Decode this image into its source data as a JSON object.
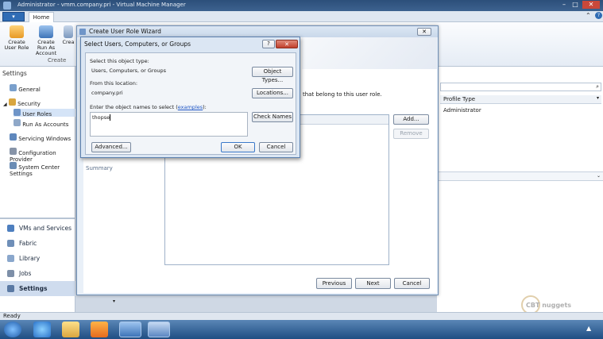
{
  "app": {
    "title": "Administrator - vmm.company.pri - Virtual Machine Manager",
    "file_tab": "▾",
    "home_tab": "Home",
    "status_text": "Ready"
  },
  "ribbon": {
    "buttons": [
      {
        "label": "Create User Role",
        "icon": "create-user-role-icon"
      },
      {
        "label": "Create Run As Account",
        "icon": "create-run-as-account-icon"
      },
      {
        "label": "Crea",
        "icon": "create-icon"
      }
    ],
    "group_label": "Create"
  },
  "leftnav": {
    "header": "Settings",
    "items": [
      {
        "label": "General",
        "icon": "general-icon"
      },
      {
        "label": "Security",
        "icon": "security-icon"
      },
      {
        "label": "User Roles",
        "icon": "user-roles-icon"
      },
      {
        "label": "Run As Accounts",
        "icon": "run-as-accounts-icon"
      },
      {
        "label": "Servicing Windows",
        "icon": "servicing-windows-icon"
      },
      {
        "label": "Configuration Provider",
        "icon": "configuration-provider-icon"
      },
      {
        "label": "System Center Settings",
        "icon": "system-center-settings-icon"
      }
    ],
    "workspaces": [
      {
        "label": "VMs and Services",
        "icon": "vms-icon"
      },
      {
        "label": "Fabric",
        "icon": "fabric-icon"
      },
      {
        "label": "Library",
        "icon": "library-icon"
      },
      {
        "label": "Jobs",
        "icon": "jobs-icon"
      },
      {
        "label": "Settings",
        "icon": "settings-icon"
      }
    ]
  },
  "grid": {
    "column_header": "Profile Type",
    "row_value": "Administrator"
  },
  "wizard": {
    "title": "Create User Role Wizard",
    "description_fragment": "that belong to this user role.",
    "step_summary": "Summary",
    "add_label": "Add...",
    "remove_label": "Remove",
    "previous_label": "Previous",
    "next_label": "Next",
    "cancel_label": "Cancel"
  },
  "dialog": {
    "title": "Select Users, Computers, or Groups",
    "help_label": "?",
    "close_label": "✕",
    "object_type_label": "Select this object type:",
    "object_type_value": "Users, Computers, or Groups",
    "object_types_button": "Object Types...",
    "location_label": "From this location:",
    "location_value": "company.pri",
    "locations_button": "Locations...",
    "names_label": "Enter the object names to select",
    "names_label_open": "(",
    "examples_link": "examples",
    "names_label_close": "):",
    "names_value": "thopse",
    "check_names_button": "Check Names",
    "advanced_button": "Advanced...",
    "ok_button": "OK",
    "cancel_button": "Cancel"
  },
  "watermark": {
    "brand": "CBT nuggets"
  },
  "colors": {
    "accent": "#2f6cb5",
    "link": "#1f56c6",
    "taskbar": "#1f4e83"
  }
}
